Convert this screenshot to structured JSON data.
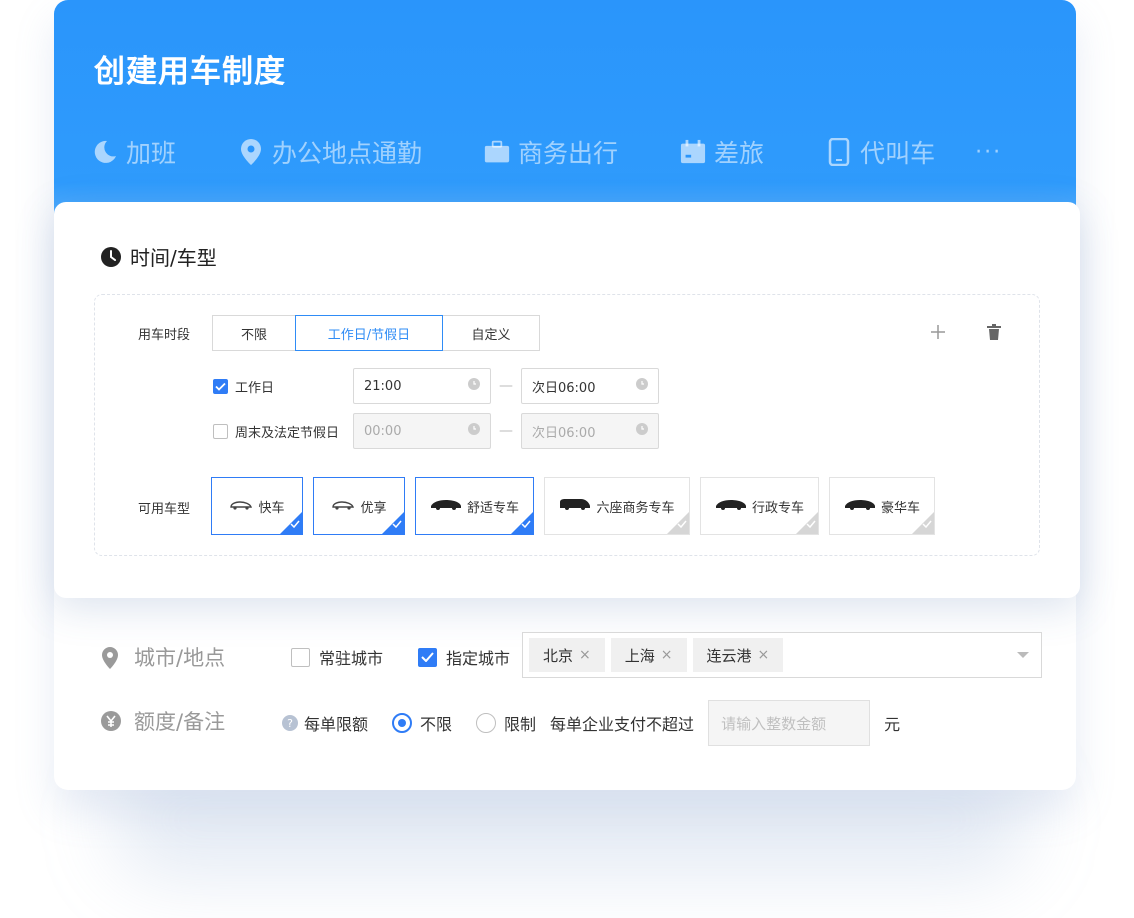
{
  "header": {
    "title": "创建用车制度",
    "tabs": [
      {
        "label": "加班",
        "icon": "moon-icon"
      },
      {
        "label": "办公地点通勤",
        "icon": "location-pin-icon"
      },
      {
        "label": "商务出行",
        "icon": "briefcase-icon"
      },
      {
        "label": "差旅",
        "icon": "calendar-icon"
      },
      {
        "label": "代叫车",
        "icon": "phone-icon"
      }
    ],
    "more_label": "···"
  },
  "time_section": {
    "title": "时间/车型",
    "period_label": "用车时段",
    "period_options": [
      "不限",
      "工作日/节假日",
      "自定义"
    ],
    "period_selected": "工作日/节假日",
    "workday": {
      "label": "工作日",
      "checked": true,
      "start": "21:00",
      "end": "次日06:00"
    },
    "holiday": {
      "label": "周末及法定节假日",
      "checked": false,
      "start": "00:00",
      "end": "次日06:00"
    },
    "separator": "—",
    "vehicle_label": "可用车型",
    "vehicles": [
      {
        "label": "快车",
        "selected": true
      },
      {
        "label": "优享",
        "selected": true
      },
      {
        "label": "舒适专车",
        "selected": true
      },
      {
        "label": "六座商务专车",
        "selected": false
      },
      {
        "label": "行政专车",
        "selected": false
      },
      {
        "label": "豪华车",
        "selected": false
      }
    ]
  },
  "city_section": {
    "label": "城市/地点",
    "resident_city": {
      "label": "常驻城市",
      "checked": false
    },
    "specified_city": {
      "label": "指定城市",
      "checked": true
    },
    "cities": [
      "北京",
      "上海",
      "连云港"
    ],
    "remove_symbol": "×"
  },
  "quota_section": {
    "label": "额度/备注",
    "per_order_label": "每单限额",
    "unlimited_label": "不限",
    "limited_label": "限制",
    "limit_text": "每单企业支付不超过",
    "amount_placeholder": "请输入整数金额",
    "unit": "元",
    "selected": "不限"
  },
  "colors": {
    "primary": "#2f8cf6",
    "header_blue": "#2a95fb"
  }
}
